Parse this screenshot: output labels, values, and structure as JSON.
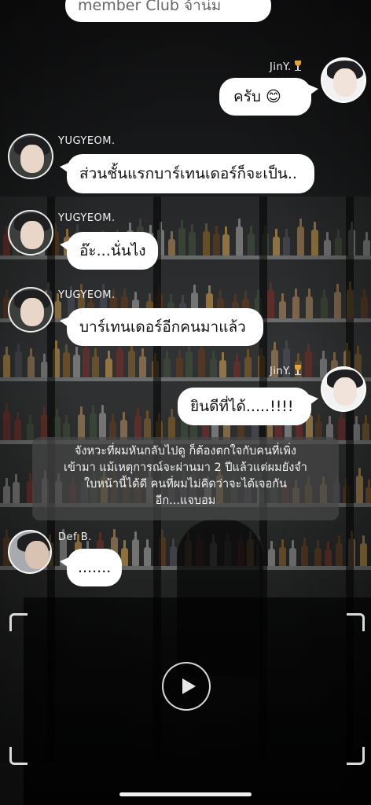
{
  "chat": {
    "top_partial_text": "member Club จ้าน่ม",
    "messages": [
      {
        "sender": "JinY.",
        "side": "right",
        "text": "ครับ 😊"
      },
      {
        "sender": "YUGYEOM.",
        "side": "left",
        "text": "ส่วนชั้นแรกบาร์เทนเดอร์ก็จะเป็น.."
      },
      {
        "sender": "YUGYEOM.",
        "side": "left",
        "text": "อ๊ะ...นั่นไง"
      },
      {
        "sender": "YUGYEOM.",
        "side": "left",
        "text": "บาร์เทนเดอร์อีกคนมาแล้ว"
      },
      {
        "sender": "JinY.",
        "side": "right",
        "text": "ยินดีที่ได้.....!!!!"
      },
      {
        "sender": "Def B.",
        "side": "left",
        "text": "......."
      }
    ],
    "narration_lines": [
      "จังหวะที่ผมหันกลับไปดู ก็ต้องตกใจกับคนที่เพิ่ง",
      "เข้ามา แม้เหตุการณ์จะผ่านมา 2 ปีแล้วแต่ผมยังจำ",
      "ใบหน้านี้ได้ดี คนที่ผมไม่คิดว่าจะได้เจอกัน",
      "อีก...แจบอม"
    ]
  },
  "icons": {
    "sender_badge": "cocktail-icon",
    "play": "play-icon"
  },
  "colors": {
    "bubble": "#ffffff",
    "narration_bg": "#464646",
    "name_text": "#f2f2f2"
  }
}
